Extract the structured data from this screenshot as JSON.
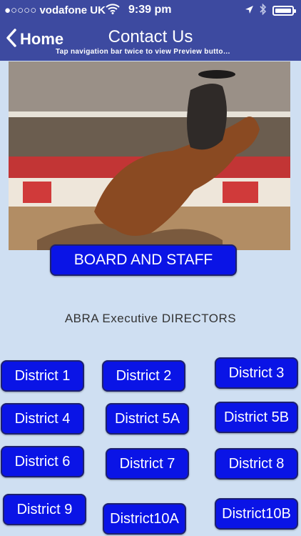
{
  "status_bar": {
    "carrier": "●○○○○ vodafone UK",
    "time": "9:39 pm"
  },
  "nav": {
    "back_label": "Home",
    "title": "Contact Us",
    "hint": "Tap navigation bar twice to view Preview butto…"
  },
  "board_button": "BOARD AND STAFF",
  "section_heading": "ABRA Executive DIRECTORS",
  "districts": [
    "District 1",
    "District 2",
    "District 3",
    "District 4",
    "District 5A",
    "District 5B",
    "District 6",
    "District 7",
    "District 8",
    "District 9",
    "District10A",
    "District10B"
  ],
  "colors": {
    "bar": "#3d4aa0",
    "button": "#0a14e6",
    "background": "#cfdff2"
  },
  "icons": [
    "wifi-icon",
    "location-arrow-icon",
    "bluetooth-icon",
    "battery-icon",
    "chevron-left-icon"
  ]
}
